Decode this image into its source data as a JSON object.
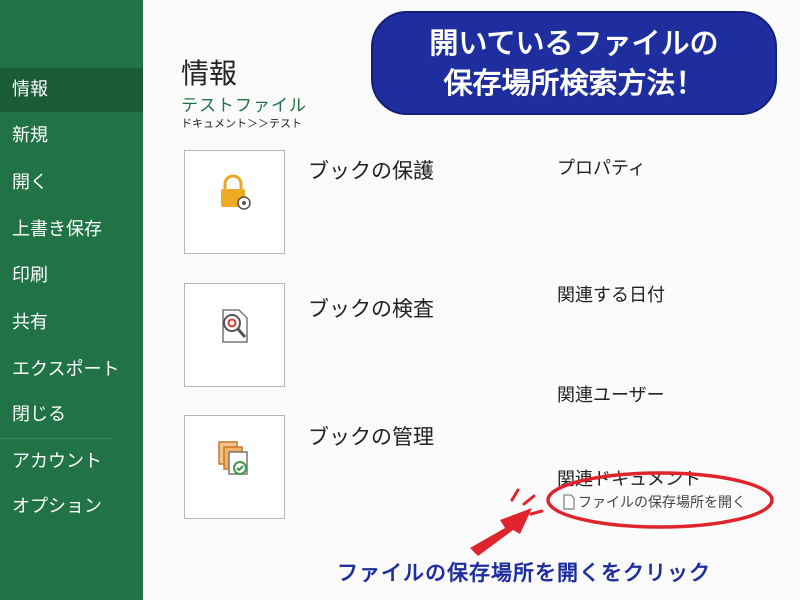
{
  "sidebar": {
    "bg": "#217346",
    "items": [
      {
        "label": "情報",
        "active": true
      },
      {
        "label": "新規"
      },
      {
        "label": "開く"
      },
      {
        "label": "上書き保存"
      },
      {
        "label": "印刷"
      },
      {
        "label": "共有"
      },
      {
        "label": "エクスポート"
      },
      {
        "label": "閉じる"
      },
      {
        "label": "アカウント"
      },
      {
        "label": "オプション"
      }
    ]
  },
  "main": {
    "title": "情報",
    "file_name": "テストファイル",
    "file_path": "ドキュメント＞＞テスト",
    "tiles": [
      {
        "label": "ブックの保護",
        "icon": "lock-icon"
      },
      {
        "label": "ブックの検査",
        "icon": "inspect-icon"
      },
      {
        "label": "ブックの管理",
        "icon": "manage-icon"
      }
    ],
    "properties": {
      "heading": "プロパティ",
      "related_dates": "関連する日付",
      "related_users": "関連ユーザー",
      "related_documents": "関連ドキュメント",
      "open_file_location": "ファイルの保存場所を開く"
    }
  },
  "banner": {
    "line1": "開いているファイルの",
    "line2": "保存場所検索方法！"
  },
  "caption": "ファイルの保存場所を開くをクリック",
  "colors": {
    "accent": "#217346",
    "banner": "#1e2e9e",
    "annotation_red": "#e0242d"
  }
}
